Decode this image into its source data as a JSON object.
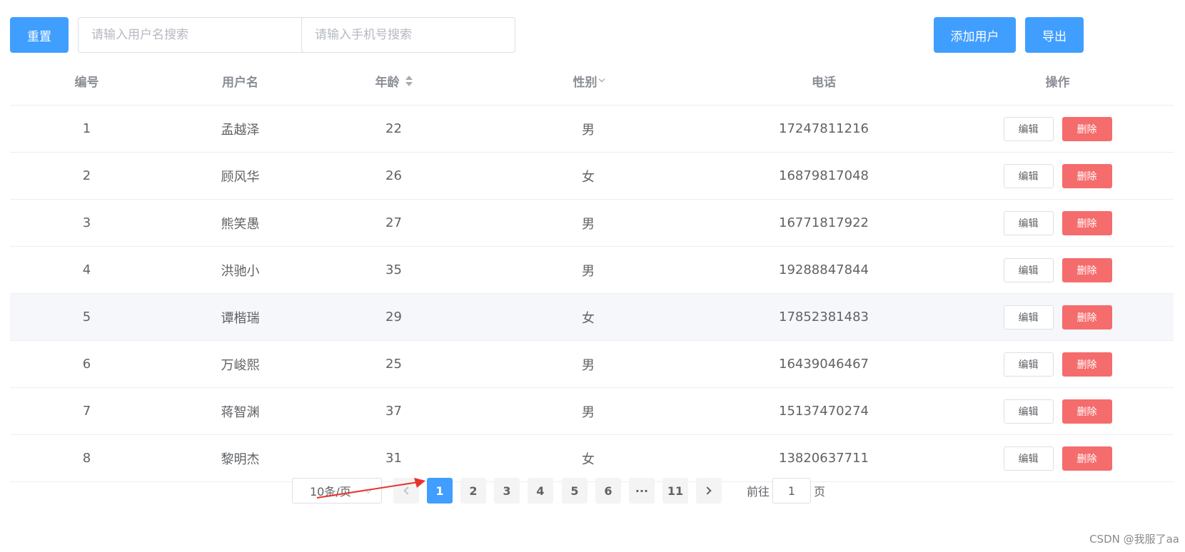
{
  "toolbar": {
    "reset_label": "重置",
    "username_placeholder": "请输入用户名搜索",
    "phone_placeholder": "请输入手机号搜索",
    "add_label": "添加用户",
    "export_label": "导出"
  },
  "table": {
    "headers": {
      "id": "编号",
      "name": "用户名",
      "age": "年龄",
      "gender": "性别",
      "phone": "电话",
      "ops": "操作"
    },
    "edit_label": "编辑",
    "delete_label": "删除",
    "rows": [
      {
        "id": "1",
        "name": "孟越泽",
        "age": "22",
        "gender": "男",
        "phone": "17247811216"
      },
      {
        "id": "2",
        "name": "顾风华",
        "age": "26",
        "gender": "女",
        "phone": "16879817048"
      },
      {
        "id": "3",
        "name": "熊笑愚",
        "age": "27",
        "gender": "男",
        "phone": "16771817922"
      },
      {
        "id": "4",
        "name": "洪驰小",
        "age": "35",
        "gender": "男",
        "phone": "19288847844"
      },
      {
        "id": "5",
        "name": "谭楷瑞",
        "age": "29",
        "gender": "女",
        "phone": "17852381483"
      },
      {
        "id": "6",
        "name": "万峻熙",
        "age": "25",
        "gender": "男",
        "phone": "16439046467"
      },
      {
        "id": "7",
        "name": "蒋智渊",
        "age": "37",
        "gender": "男",
        "phone": "15137470274"
      },
      {
        "id": "8",
        "name": "黎明杰",
        "age": "31",
        "gender": "女",
        "phone": "13820637711"
      }
    ]
  },
  "pagination": {
    "page_size": "10条/页",
    "pages": [
      "1",
      "2",
      "3",
      "4",
      "5",
      "6",
      "···",
      "11"
    ],
    "current": "1",
    "goto_label": "前往",
    "goto_value": "1",
    "page_unit": "页"
  },
  "watermark": "CSDN @我服了aa",
  "colors": {
    "primary": "#409eff",
    "danger": "#f56c6c",
    "annotation_arrow": "#e8322e"
  }
}
